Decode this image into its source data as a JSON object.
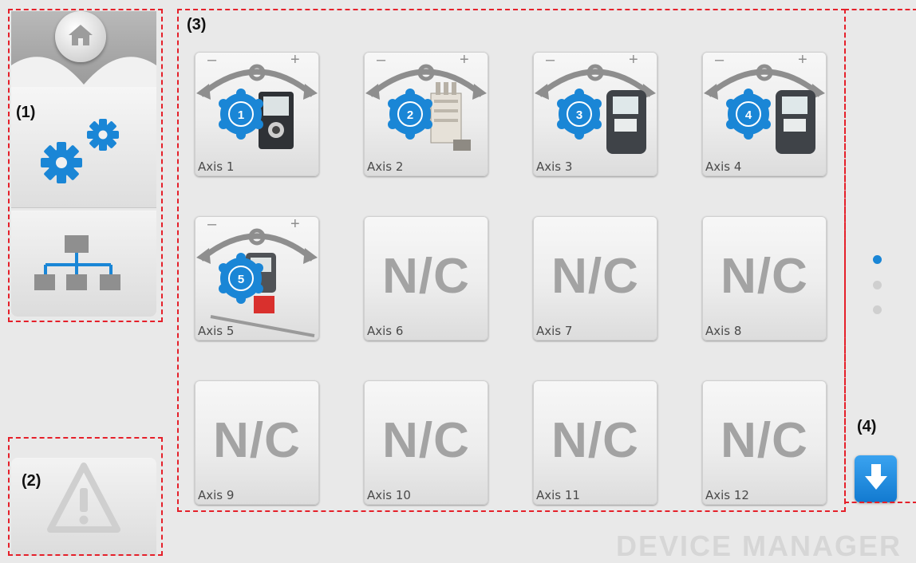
{
  "callouts": [
    "(1)",
    "(2)",
    "(3)",
    "(4)"
  ],
  "sidebar": {
    "items": [
      {
        "name": "home",
        "icon": "home-icon"
      },
      {
        "name": "settings",
        "icon": "gears-icon"
      },
      {
        "name": "network",
        "icon": "network-tree-icon"
      }
    ],
    "warning_icon": "warning-icon"
  },
  "axes": [
    {
      "label": "Axis 1",
      "number": "1",
      "connected": true,
      "device": "display-actuator"
    },
    {
      "label": "Axis 2",
      "number": "2",
      "connected": true,
      "device": "pneumatic-module"
    },
    {
      "label": "Axis 3",
      "number": "3",
      "connected": true,
      "device": "display-actuator-dark"
    },
    {
      "label": "Axis 4",
      "number": "4",
      "connected": true,
      "device": "display-actuator-dark"
    },
    {
      "label": "Axis 5",
      "number": "5",
      "connected": true,
      "device": "linear-actuator"
    },
    {
      "label": "Axis 6",
      "nc": "N/C",
      "connected": false
    },
    {
      "label": "Axis 7",
      "nc": "N/C",
      "connected": false
    },
    {
      "label": "Axis 8",
      "nc": "N/C",
      "connected": false
    },
    {
      "label": "Axis 9",
      "nc": "N/C",
      "connected": false
    },
    {
      "label": "Axis 10",
      "nc": "N/C",
      "connected": false
    },
    {
      "label": "Axis 11",
      "nc": "N/C",
      "connected": false
    },
    {
      "label": "Axis 12",
      "nc": "N/C",
      "connected": false
    }
  ],
  "pager": {
    "pages": 3,
    "current_page": 1
  },
  "scroll_down_icon": "arrow-down-icon",
  "footer_title": "DEVICE MANAGER",
  "colors": {
    "accent": "#1a86d6",
    "annotation": "#e5202a",
    "nc_text": "#a3a3a3",
    "inactive_dot": "#cfcfcf"
  }
}
